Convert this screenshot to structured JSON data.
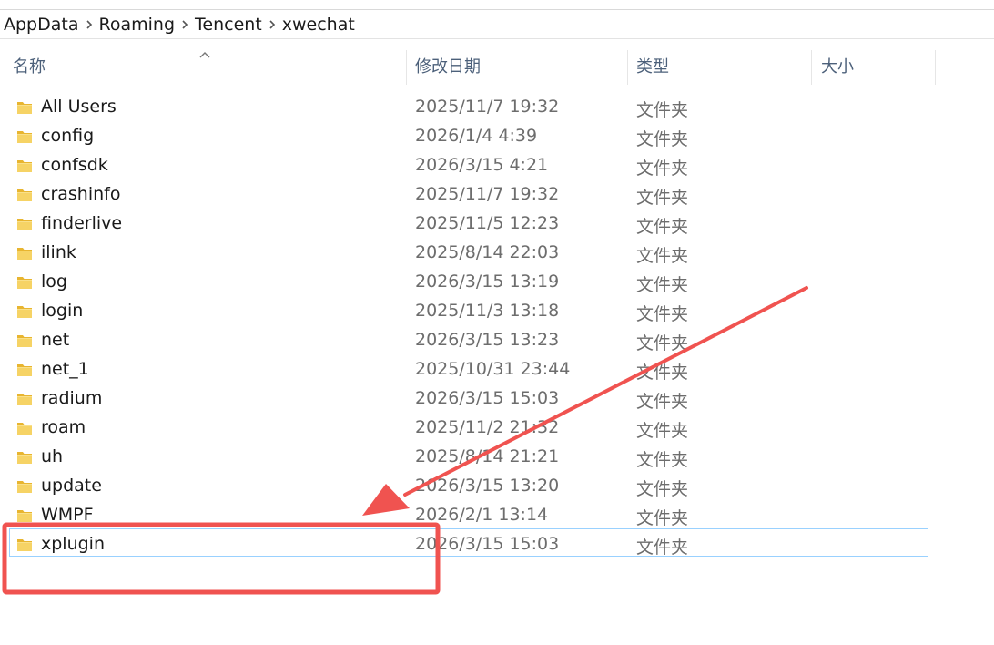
{
  "breadcrumb": [
    "AppData",
    "Roaming",
    "Tencent",
    "xwechat"
  ],
  "columns": {
    "name": "名称",
    "date": "修改日期",
    "type": "类型",
    "size": "大小"
  },
  "files": [
    {
      "name": "All Users",
      "date": "2025/11/7 19:32",
      "type": "文件夹"
    },
    {
      "name": "config",
      "date": "2026/1/4 4:39",
      "type": "文件夹"
    },
    {
      "name": "confsdk",
      "date": "2026/3/15 4:21",
      "type": "文件夹"
    },
    {
      "name": "crashinfo",
      "date": "2025/11/7 19:32",
      "type": "文件夹"
    },
    {
      "name": "finderlive",
      "date": "2025/11/5 12:23",
      "type": "文件夹"
    },
    {
      "name": "ilink",
      "date": "2025/8/14 22:03",
      "type": "文件夹"
    },
    {
      "name": "log",
      "date": "2026/3/15 13:19",
      "type": "文件夹"
    },
    {
      "name": "login",
      "date": "2025/11/3 13:18",
      "type": "文件夹"
    },
    {
      "name": "net",
      "date": "2026/3/15 13:23",
      "type": "文件夹"
    },
    {
      "name": "net_1",
      "date": "2025/10/31 23:44",
      "type": "文件夹"
    },
    {
      "name": "radium",
      "date": "2026/3/15 15:03",
      "type": "文件夹"
    },
    {
      "name": "roam",
      "date": "2025/11/2 21:32",
      "type": "文件夹"
    },
    {
      "name": "uh",
      "date": "2025/8/14 21:21",
      "type": "文件夹"
    },
    {
      "name": "update",
      "date": "2026/3/15 13:20",
      "type": "文件夹"
    },
    {
      "name": "WMPF",
      "date": "2026/2/1 13:14",
      "type": "文件夹"
    },
    {
      "name": "xplugin",
      "date": "2026/3/15 15:03",
      "type": "文件夹"
    }
  ],
  "selected_file": "xplugin",
  "annotation": {
    "color": "#f05350",
    "highlight_target": "xplugin"
  },
  "icons": {
    "folder": "folder-icon",
    "separator": "chevron-right-icon",
    "sort": "sort-up-icon"
  },
  "colors": {
    "folder": "#f2c44a",
    "selection_border": "#99d1ff",
    "header_text": "#4c607a"
  }
}
